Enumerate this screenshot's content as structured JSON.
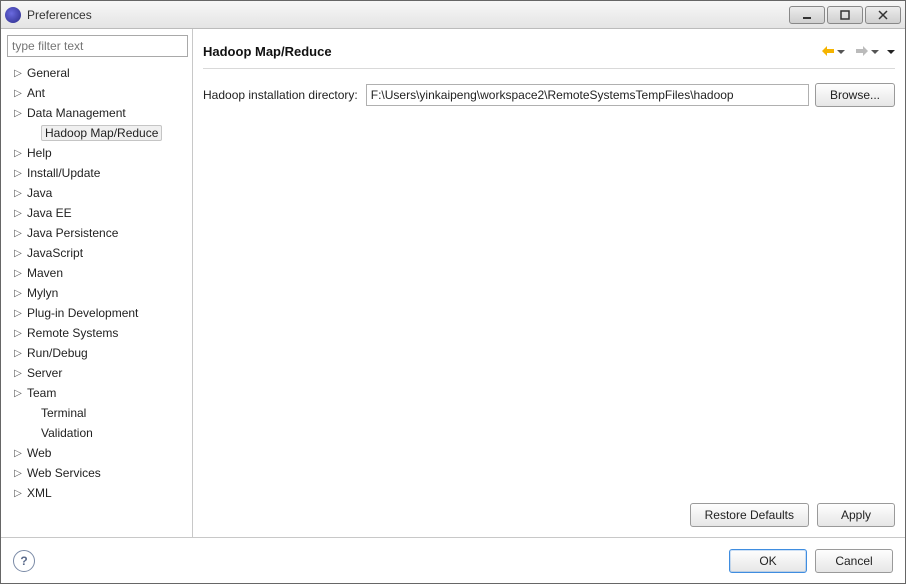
{
  "window": {
    "title": "Preferences"
  },
  "filter": {
    "placeholder": "type filter text"
  },
  "tree": {
    "items": [
      {
        "label": "General",
        "expandable": true
      },
      {
        "label": "Ant",
        "expandable": true
      },
      {
        "label": "Data Management",
        "expandable": true
      },
      {
        "label": "Hadoop Map/Reduce",
        "expandable": false,
        "level": 1,
        "selected": true
      },
      {
        "label": "Help",
        "expandable": true
      },
      {
        "label": "Install/Update",
        "expandable": true
      },
      {
        "label": "Java",
        "expandable": true
      },
      {
        "label": "Java EE",
        "expandable": true
      },
      {
        "label": "Java Persistence",
        "expandable": true
      },
      {
        "label": "JavaScript",
        "expandable": true
      },
      {
        "label": "Maven",
        "expandable": true
      },
      {
        "label": "Mylyn",
        "expandable": true
      },
      {
        "label": "Plug-in Development",
        "expandable": true
      },
      {
        "label": "Remote Systems",
        "expandable": true
      },
      {
        "label": "Run/Debug",
        "expandable": true
      },
      {
        "label": "Server",
        "expandable": true
      },
      {
        "label": "Team",
        "expandable": true
      },
      {
        "label": "Terminal",
        "expandable": false,
        "level": 1
      },
      {
        "label": "Validation",
        "expandable": false,
        "level": 1
      },
      {
        "label": "Web",
        "expandable": true
      },
      {
        "label": "Web Services",
        "expandable": true
      },
      {
        "label": "XML",
        "expandable": true
      }
    ]
  },
  "page": {
    "title": "Hadoop Map/Reduce",
    "field_label": "Hadoop installation directory:",
    "field_value": "F:\\Users\\yinkaipeng\\workspace2\\RemoteSystemsTempFiles\\hadoop",
    "browse_label": "Browse...",
    "restore_label": "Restore Defaults",
    "apply_label": "Apply"
  },
  "footer": {
    "ok_label": "OK",
    "cancel_label": "Cancel"
  }
}
